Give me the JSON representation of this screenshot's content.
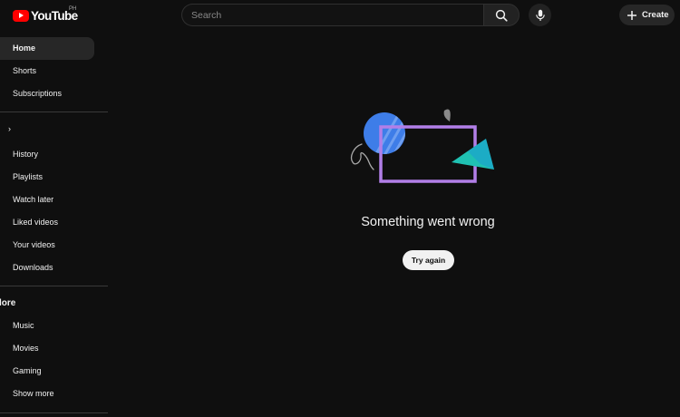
{
  "header": {
    "logo_text": "YouTube",
    "country_code": "PH",
    "search_placeholder": "Search",
    "create_label": "Create",
    "brand_color": "#ff0000"
  },
  "sidebar": {
    "main": [
      {
        "label": "Home",
        "active": true
      },
      {
        "label": "Shorts"
      },
      {
        "label": "Subscriptions"
      }
    ],
    "you": [
      {
        "label": "History"
      },
      {
        "label": "Playlists"
      },
      {
        "label": "Watch later"
      },
      {
        "label": "Liked videos"
      },
      {
        "label": "Your videos"
      },
      {
        "label": "Downloads"
      }
    ],
    "explore_title": "lore",
    "explore": [
      {
        "label": "Music"
      },
      {
        "label": "Movies"
      },
      {
        "label": "Gaming"
      },
      {
        "label": "Show more"
      }
    ]
  },
  "main": {
    "error_message": "Something went wrong",
    "retry_label": "Try again",
    "illustration_colors": {
      "circle": "#3e7de8",
      "frame": "#b27fe8",
      "triangle": "#1fc1b2",
      "leaf": "#8a8a8a"
    }
  }
}
